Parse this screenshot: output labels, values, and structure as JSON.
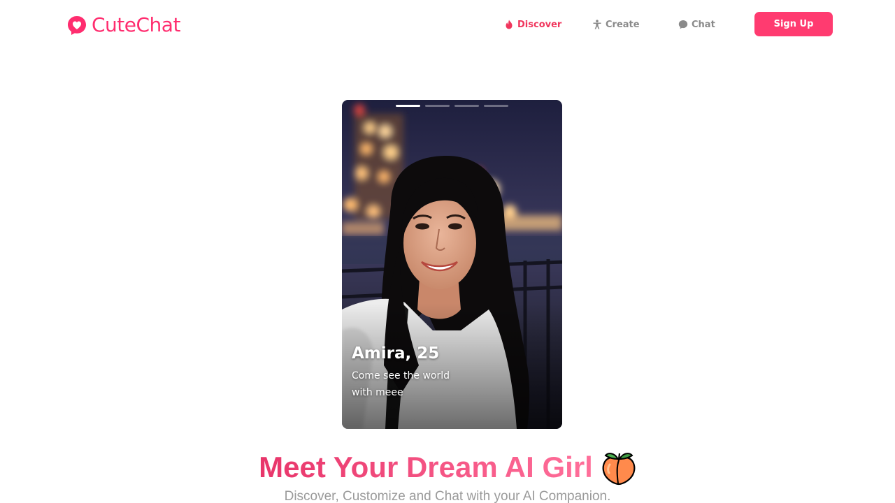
{
  "header": {
    "brand": "CuteChat",
    "nav": {
      "discover": "Discover",
      "create": "Create",
      "chat": "Chat"
    },
    "signup_label": "Sign Up"
  },
  "profile_card": {
    "name_age": "Amira, 25",
    "bio": "Come see the world with meee",
    "photo_slides_total": 4,
    "active_slide": 1
  },
  "hero": {
    "title": "Meet Your Dream AI Girl",
    "title_emoji": "peach-icon",
    "subtitle": "Discover, Customize and Chat with your AI Companion."
  },
  "colors": {
    "brand": "#ff2d6f",
    "accent": "#f0365d",
    "button": "#ff3b70",
    "nav_inactive": "#8a8a8a",
    "subtitle": "#9a9a9a"
  },
  "icons": [
    "heart-chat-logo-icon",
    "flame-icon",
    "person-icon",
    "chat-bubble-icon",
    "peach-icon"
  ]
}
